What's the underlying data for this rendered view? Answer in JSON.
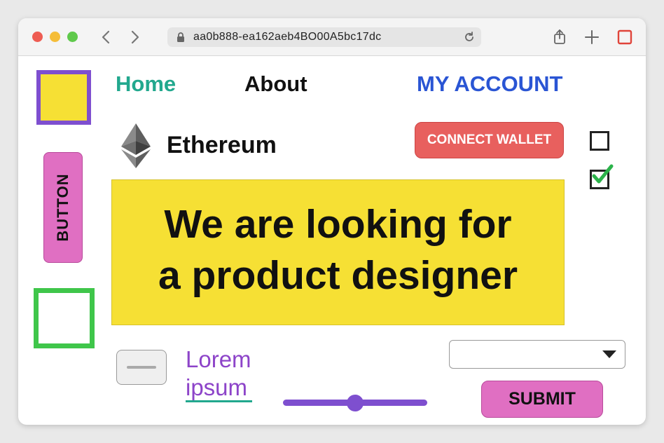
{
  "browser": {
    "url": "aa0b888-ea162aeb4BO00A5bc17dc"
  },
  "nav": {
    "home_label": "Home",
    "about_label": "About",
    "account_label": "MY ACCOUNT"
  },
  "brand": {
    "label": "Ethereum",
    "icon": "ethereum-icon"
  },
  "connect_wallet": {
    "label": "CONNECT WALLET"
  },
  "checkboxes": [
    {
      "checked": false
    },
    {
      "checked": true
    }
  ],
  "side": {
    "button_label": "BUTTON"
  },
  "banner": {
    "line1": "We are looking for",
    "line2": "a product designer"
  },
  "lorem": {
    "line1": "Lorem",
    "line2": "ipsum"
  },
  "slider": {
    "value": 0.5
  },
  "dropdown": {
    "selected": ""
  },
  "submit": {
    "label": "SUBMIT"
  },
  "colors": {
    "yellow": "#f6e034",
    "purple": "#7e4fcf",
    "pink": "#e06fc2",
    "green": "#3fc64a",
    "teal": "#22a88e",
    "blue": "#2a55d4",
    "coral": "#e8605e"
  }
}
